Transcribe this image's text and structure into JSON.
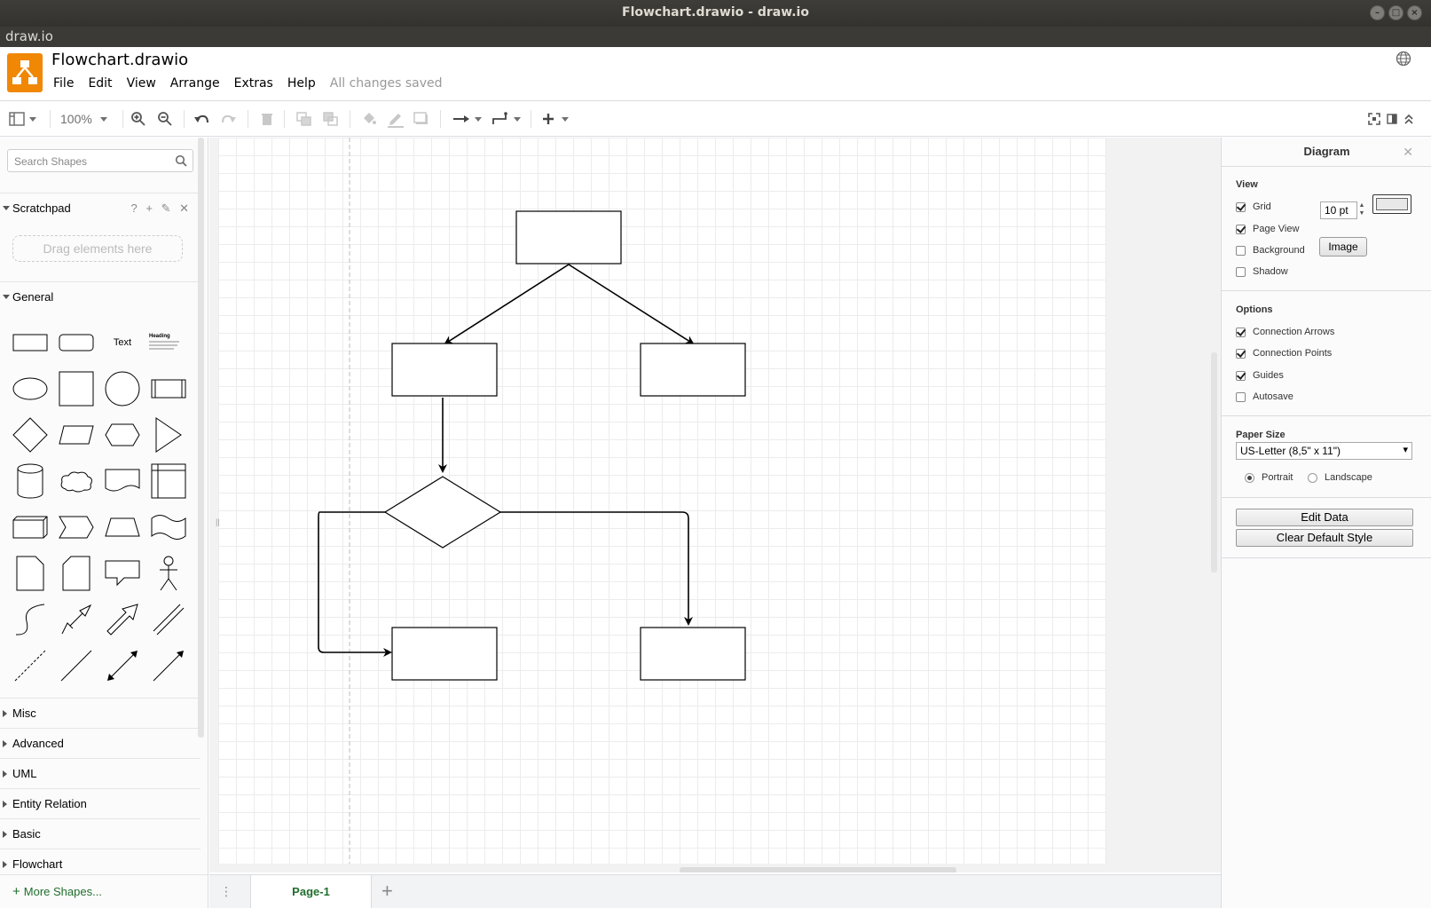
{
  "window": {
    "title": "Flowchart.drawio - draw.io",
    "app_name": "draw.io"
  },
  "header": {
    "doc_title": "Flowchart.drawio",
    "menu": [
      "File",
      "Edit",
      "View",
      "Arrange",
      "Extras",
      "Help"
    ],
    "status": "All changes saved"
  },
  "toolbar": {
    "zoom": "100%"
  },
  "sidebar": {
    "search_placeholder": "Search Shapes",
    "scratchpad": {
      "title": "Scratchpad",
      "tools": "? + ✎ ✕",
      "dropzone": "Drag elements here"
    },
    "general_title": "General",
    "shape_text": "Text",
    "shape_heading": "Heading",
    "sections": [
      "Misc",
      "Advanced",
      "UML",
      "Entity Relation",
      "Basic",
      "Flowchart"
    ],
    "more_shapes": "More Shapes..."
  },
  "pages": {
    "tabs": [
      "Page-1"
    ]
  },
  "format_panel": {
    "title": "Diagram",
    "view": {
      "heading": "View",
      "grid": {
        "label": "Grid",
        "checked": true,
        "size": "10 pt"
      },
      "page_view": {
        "label": "Page View",
        "checked": true
      },
      "background": {
        "label": "Background",
        "checked": false,
        "button": "Image"
      },
      "shadow": {
        "label": "Shadow",
        "checked": false
      }
    },
    "options": {
      "heading": "Options",
      "items": [
        {
          "label": "Connection Arrows",
          "checked": true
        },
        {
          "label": "Connection Points",
          "checked": true
        },
        {
          "label": "Guides",
          "checked": true
        },
        {
          "label": "Autosave",
          "checked": false
        }
      ]
    },
    "paper": {
      "heading": "Paper Size",
      "selected": "US-Letter (8,5\" x 11\")",
      "portrait": "Portrait",
      "landscape": "Landscape",
      "orientation": "portrait"
    },
    "buttons": {
      "edit_data": "Edit Data",
      "clear_style": "Clear Default Style"
    }
  },
  "colors": {
    "accent": "#f08705",
    "page_tab": "#216e2d"
  }
}
